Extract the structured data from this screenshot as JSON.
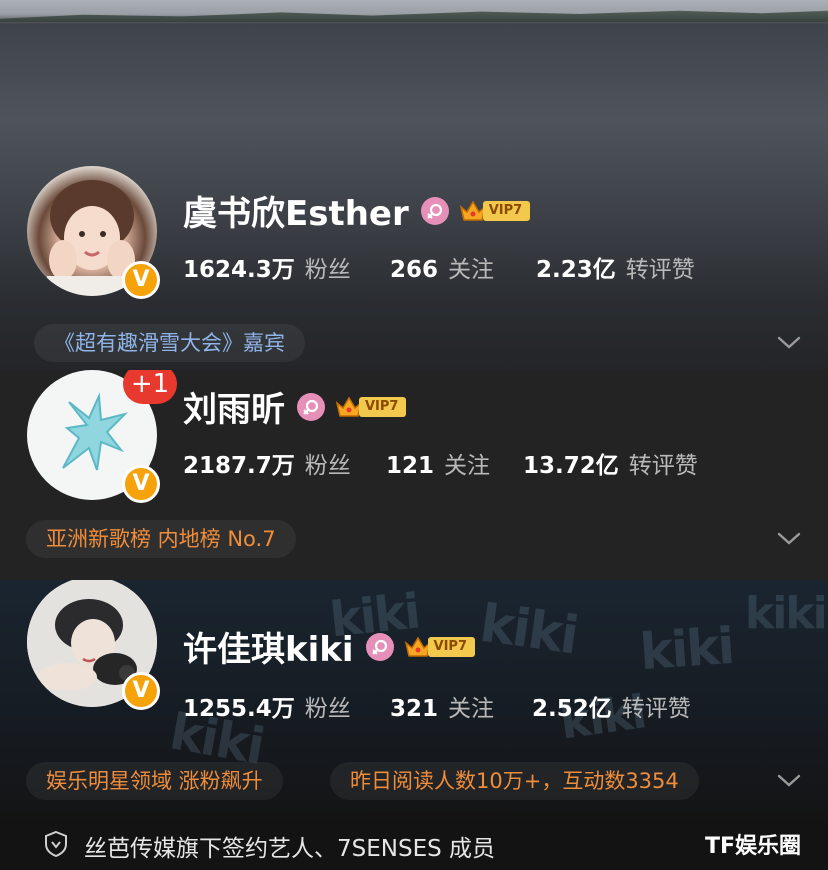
{
  "cards": [
    {
      "name": "虞书欣Esther",
      "vip_label": "VIP7",
      "stats": [
        {
          "value": "1624.3万",
          "label": "粉丝"
        },
        {
          "value": "266",
          "label": "关注"
        },
        {
          "value": "2.23亿",
          "label": "转评赞"
        }
      ],
      "tags": [
        "《超有趣滑雪大会》嘉宾"
      ],
      "tag_color": "#8fb4e8"
    },
    {
      "name": "刘雨昕",
      "vip_label": "VIP7",
      "avatar_badge": "+1",
      "stats": [
        {
          "value": "2187.7万",
          "label": "粉丝"
        },
        {
          "value": "121",
          "label": "关注"
        },
        {
          "value": "13.72亿",
          "label": "转评赞"
        }
      ],
      "tags": [
        "亚洲新歌榜 内地榜 No.7"
      ],
      "tag_color": "#ef8d3a"
    },
    {
      "name": "许佳琪kiki",
      "vip_label": "VIP7",
      "stats": [
        {
          "value": "1255.4万",
          "label": "粉丝"
        },
        {
          "value": "321",
          "label": "关注"
        },
        {
          "value": "2.52亿",
          "label": "转评赞"
        }
      ],
      "tags": [
        "娱乐明星领域 涨粉飙升",
        "昨日阅读人数10万+，互动数3354"
      ],
      "tag_color": "#ef8d3a",
      "background_text": "kiki"
    }
  ],
  "verified_badge": "V",
  "footer": {
    "description": "丝芭传媒旗下签约艺人、7SENSES 成员",
    "watermark": "TF娱乐圈"
  },
  "colors": {
    "vip_gold": "#f2c94c",
    "verified_orange": "#f5a20b",
    "female_pink": "#e58fb9",
    "badge_red": "#e8392f"
  },
  "icons": [
    "chevron-down-icon",
    "female-icon",
    "crown-icon",
    "shield-icon",
    "verified-v-icon"
  ]
}
